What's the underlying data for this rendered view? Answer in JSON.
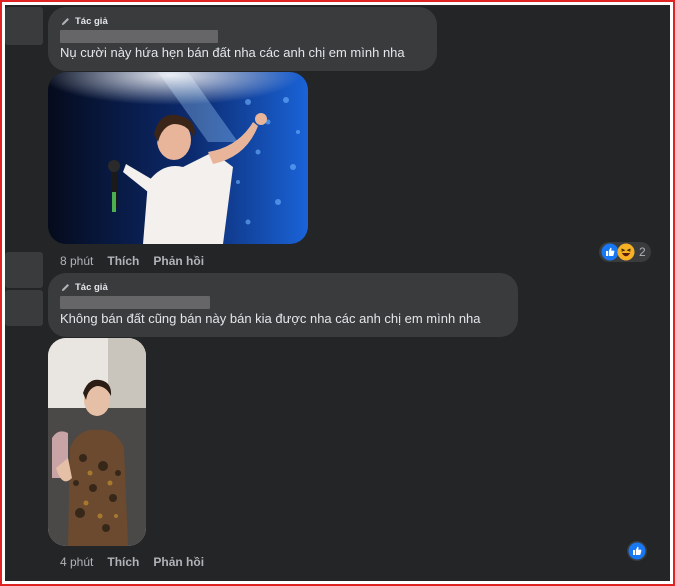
{
  "comments": [
    {
      "author_badge": "Tác giả",
      "text": "Nụ cười này hứa hẹn bán đất nha các anh chị em mình nha",
      "time": "8 phút",
      "like_label": "Thích",
      "reply_label": "Phản hồi",
      "reaction_count": "2",
      "reactions": [
        "like-icon",
        "haha-icon"
      ]
    },
    {
      "author_badge": "Tác giả",
      "text": "Không bán đất cũng bán này bán kia được nha các anh chị em mình nha",
      "time": "4 phút",
      "like_label": "Thích",
      "reply_label": "Phản hồi",
      "reaction_count": "",
      "reactions": [
        "like-icon"
      ]
    }
  ],
  "colors": {
    "background": "#242526",
    "bubble": "#3a3b3c",
    "text": "#e4e6eb",
    "secondary_text": "#b0b3b8",
    "like_blue": "#1877f2",
    "haha_yellow": "#f7b125",
    "frame_red": "#e02424"
  }
}
